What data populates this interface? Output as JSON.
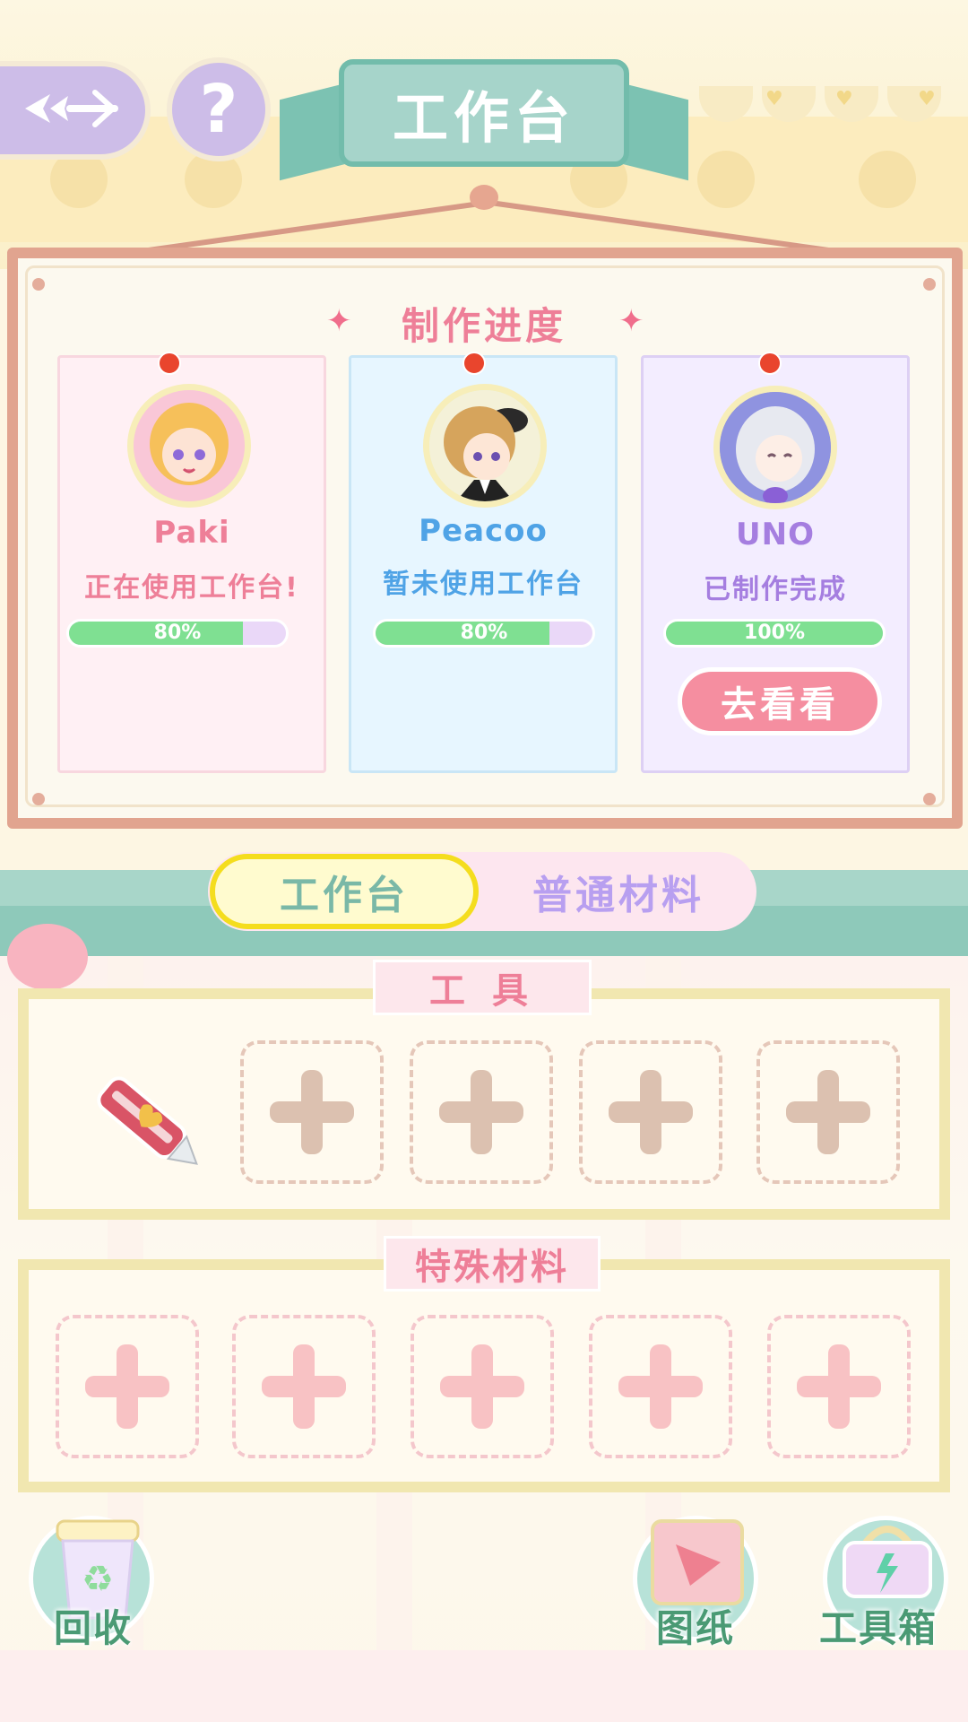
{
  "header": {
    "title": "工作台",
    "back_icon": "back-arrow-icon",
    "help_label": "?"
  },
  "progress": {
    "title": "制作进度",
    "characters": [
      {
        "name": "Paki",
        "status": "正在使用工作台!",
        "progress": 80,
        "progress_label": "80%",
        "name_color": "#ee7f98",
        "status_color": "#ee7f98"
      },
      {
        "name": "Peacoo",
        "status": "暂未使用工作台",
        "progress": 80,
        "progress_label": "80%",
        "name_color": "#4fa3e6",
        "status_color": "#4fa3e6"
      },
      {
        "name": "UNO",
        "status": "已制作完成",
        "progress": 100,
        "progress_label": "100%",
        "name_color": "#a57ee0",
        "status_color": "#a57ee0"
      }
    ],
    "go_button": "去看看"
  },
  "tabs": {
    "active": "工作台",
    "inactive": "普通材料"
  },
  "tools": {
    "label": "工 具",
    "equipped_icon": "utility-knife-icon"
  },
  "special": {
    "label": "特殊材料"
  },
  "bottom": {
    "recycle": "回收",
    "blueprint": "图纸",
    "toolbox": "工具箱"
  },
  "colors": {
    "accent_pink": "#ee7f98",
    "teal": "#a6d4ca",
    "progress_green": "#7fe092",
    "active_tab_border": "#f4dd1e"
  }
}
